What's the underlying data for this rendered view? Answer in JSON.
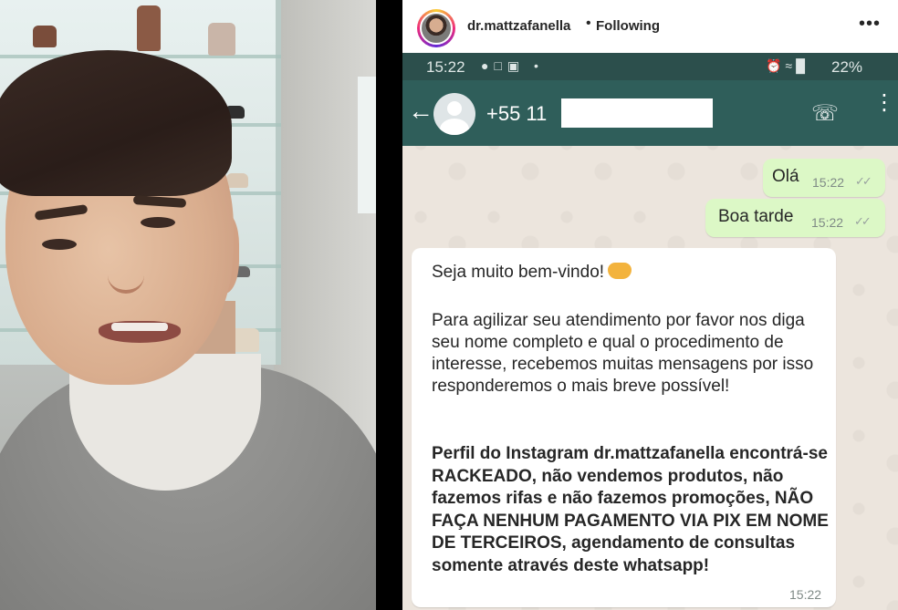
{
  "post": {
    "username": "dr.mattzafanella",
    "separator": "•",
    "follow_status": "Following",
    "more_icon": "more-options-icon"
  },
  "whatsapp": {
    "status_bar": {
      "time": "15:22",
      "battery": "22%"
    },
    "contact": {
      "name": "+55 11"
    },
    "messages": [
      {
        "direction": "outgoing",
        "text": "Olá",
        "time": "15:22",
        "status": "read"
      },
      {
        "direction": "outgoing",
        "text": "Boa tarde",
        "time": "15:22",
        "status": "read"
      },
      {
        "direction": "incoming",
        "greeting": "Seja muito bem-vindo!",
        "body": "Para agilizar seu atendimento por favor nos diga seu nome completo e qual o procedimento de interesse, recebemos muitas mensagens por isso responderemos o mais breve possível!",
        "warning": "Perfil do Instagram dr.mattzafanella encontrá-se RACKEADO, não vendemos produtos, não fazemos rifas e não fazemos promoções, NÃO FAÇA NENHUM PAGAMENTO VIA PIX EM NOME DE TERCEIROS, agendamento de consultas somente através deste whatsapp!",
        "time": "15:22"
      }
    ]
  },
  "colors": {
    "wa_header": "#2f5e5a",
    "wa_status": "#2c4f4c",
    "outgoing_bubble": "#dcf8c6",
    "chat_background": "#ece5dd"
  }
}
